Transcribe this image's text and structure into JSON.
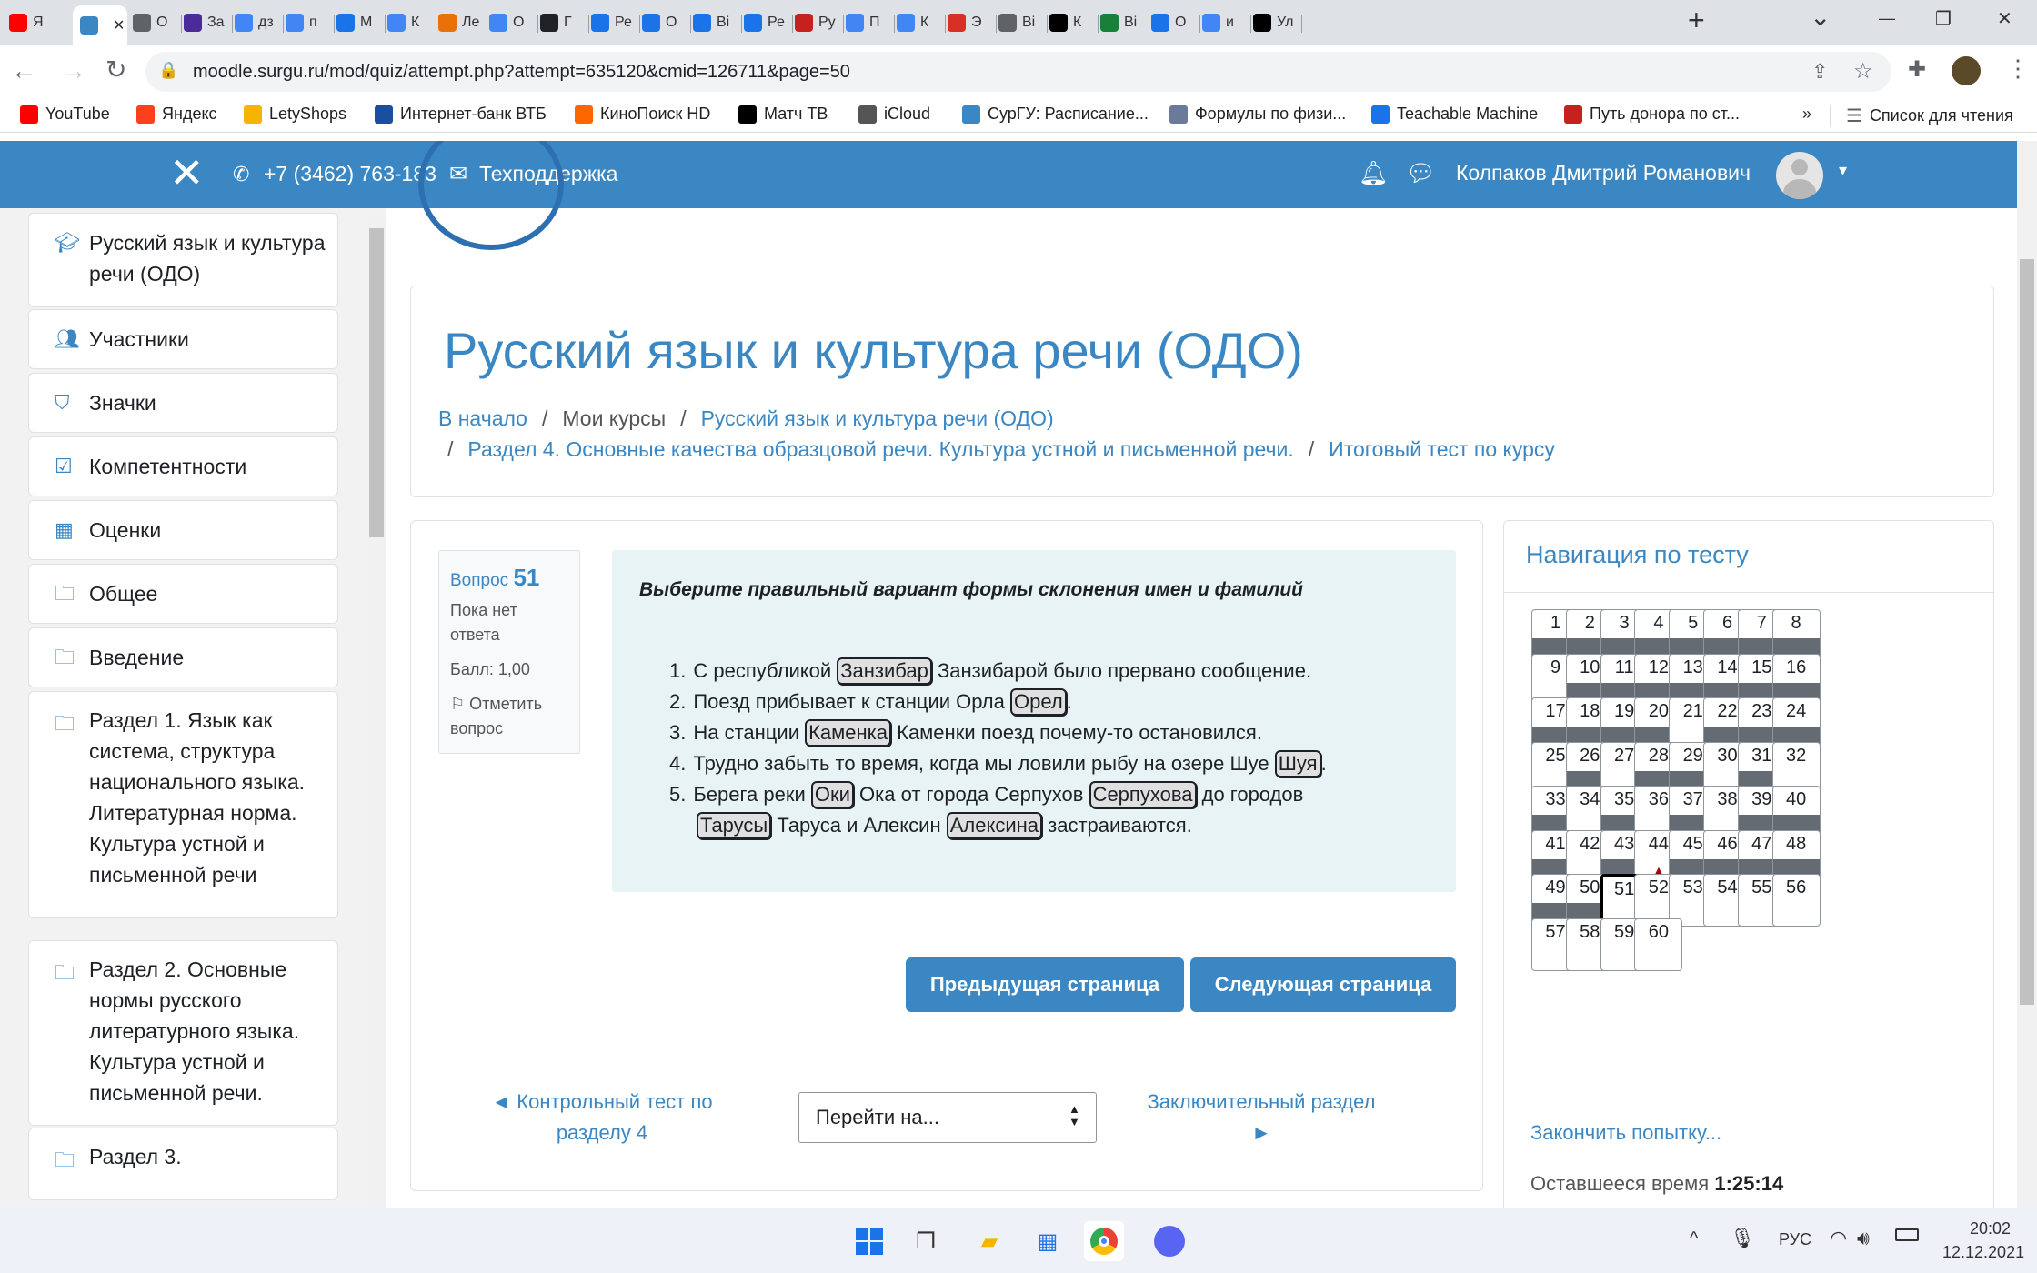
{
  "browser": {
    "tabs": [
      {
        "label": "Я",
        "icon": "youtube-icon",
        "color": "#ff0000"
      },
      {
        "label": "",
        "icon": "moodle-icon",
        "color": "#3a87c4",
        "active": true
      },
      {
        "label": "О",
        "icon": "globe-icon",
        "color": "#5f6368"
      },
      {
        "label": "За",
        "icon": "question-icon",
        "color": "#4b2a9a"
      },
      {
        "label": "дз",
        "icon": "google-icon",
        "color": "#4285f4"
      },
      {
        "label": "п",
        "icon": "google-icon",
        "color": "#4285f4"
      },
      {
        "label": "М",
        "icon": "chat-icon",
        "color": "#1a73e8"
      },
      {
        "label": "К",
        "icon": "google-icon",
        "color": "#4285f4"
      },
      {
        "label": "Ле",
        "icon": "phi-icon",
        "color": "#e8710a"
      },
      {
        "label": "О",
        "icon": "google-icon",
        "color": "#4285f4"
      },
      {
        "label": "Г",
        "icon": "figure-icon",
        "color": "#202124"
      },
      {
        "label": "Ре",
        "icon": "question-circle-icon",
        "color": "#1a73e8"
      },
      {
        "label": "О",
        "icon": "bulb-icon",
        "color": "#1a73e8"
      },
      {
        "label": "Ві",
        "icon": "book-icon",
        "color": "#1a73e8"
      },
      {
        "label": "Ре",
        "icon": "s-icon",
        "color": "#1a73e8"
      },
      {
        "label": "Ру",
        "icon": "emblem-icon",
        "color": "#c5221f"
      },
      {
        "label": "П",
        "icon": "google-icon",
        "color": "#4285f4"
      },
      {
        "label": "К",
        "icon": "google-icon",
        "color": "#4285f4"
      },
      {
        "label": "Э",
        "icon": "briefcase-icon",
        "color": "#d93025"
      },
      {
        "label": "Ві",
        "icon": "globe-icon",
        "color": "#5f6368"
      },
      {
        "label": "К",
        "icon": "m-icon",
        "color": "#000000"
      },
      {
        "label": "Ві",
        "icon": "check-icon",
        "color": "#188038"
      },
      {
        "label": "О",
        "icon": "question-icon",
        "color": "#1a73e8"
      },
      {
        "label": "и",
        "icon": "google-icon",
        "color": "#4285f4"
      },
      {
        "label": "Ул",
        "icon": "3-icon",
        "color": "#000000"
      }
    ],
    "new_tab": "+",
    "url": "moodle.surgu.ru/mod/quiz/attempt.php?attempt=635120&cmid=126711&page=50",
    "bookmarks": [
      {
        "label": "YouTube",
        "icon": "youtube-icon",
        "color": "#ff0000"
      },
      {
        "label": "Яндекс",
        "icon": "yandex-icon",
        "color": "#fc3f1d"
      },
      {
        "label": "LetyShops",
        "icon": "letyshops-icon",
        "color": "#f4b400"
      },
      {
        "label": "Интернет-банк ВТБ",
        "icon": "vtb-icon",
        "color": "#1a4fa0"
      },
      {
        "label": "КиноПоиск HD",
        "icon": "kinopoisk-icon",
        "color": "#ff6600"
      },
      {
        "label": "Матч ТВ",
        "icon": "matchtv-icon",
        "color": "#000000"
      },
      {
        "label": "iCloud",
        "icon": "apple-icon",
        "color": "#555555"
      },
      {
        "label": "СурГУ: Расписание...",
        "icon": "surgu-icon",
        "color": "#3a87c4"
      },
      {
        "label": "Формулы по физи...",
        "icon": "formula-icon",
        "color": "#6a7b9a"
      },
      {
        "label": "Teachable Machine",
        "icon": "tm-icon",
        "color": "#1a73e8"
      },
      {
        "label": "Путь донора по ст...",
        "icon": "donor-icon",
        "color": "#c5221f"
      }
    ],
    "bookmarks_more": "»",
    "reading_list": "Список для чтения"
  },
  "navbar": {
    "phone": "+7 (3462) 763-183",
    "support": "Техподдержка",
    "user_name": "Колпаков Дмитрий Романович"
  },
  "drawer": {
    "items": [
      {
        "label": "Русский язык и культура речи (ОДО)",
        "icon": "graduation-cap-icon"
      },
      {
        "label": "Участники",
        "icon": "users-icon"
      },
      {
        "label": "Значки",
        "icon": "shield-icon"
      },
      {
        "label": "Компетентности",
        "icon": "checkbox-icon"
      },
      {
        "label": "Оценки",
        "icon": "table-icon"
      },
      {
        "label": "Общее",
        "icon": "folder-icon"
      },
      {
        "label": "Введение",
        "icon": "folder-icon"
      },
      {
        "label": "Раздел 1. Язык как система, структура национального языка. Литературная норма. Культура устной и письменной речи",
        "icon": "folder-icon"
      },
      {
        "label": "Раздел 2. Основные нормы русского литературного языка. Культура устной и письменной речи.",
        "icon": "folder-icon"
      },
      {
        "label": "Раздел 3.",
        "icon": "folder-icon"
      }
    ]
  },
  "header": {
    "course_title": "Русский язык и культура речи (ОДО)",
    "breadcrumb": [
      "В начало",
      "Мои курсы",
      "Русский язык и культура речи (ОДО)",
      "Раздел 4. Основные качества образцовой речи. Культура устной и письменной речи.",
      "Итоговый тест по курсу"
    ],
    "separator": "/"
  },
  "question": {
    "label": "Вопрос",
    "number": "51",
    "status": "Пока нет ответа",
    "grade": "Балл: 1,00",
    "flag": "Отметить вопрос",
    "prompt": "Выберите правильный вариант формы склонения имен и фамилий",
    "items": [
      {
        "n": "1.",
        "a": "С республикой ",
        "b1": "Занзибар",
        "c": " Занзибарой было прервано сообщение.",
        "b2": "",
        "d": "",
        "b3": "",
        "e": ""
      },
      {
        "n": "2.",
        "a": "Поезд прибывает к станции Орла ",
        "b1": "Орел",
        "c": ".",
        "b2": "",
        "d": "",
        "b3": "",
        "e": ""
      },
      {
        "n": "3.",
        "a": "На станции ",
        "b1": "Каменка",
        "c": " Каменки поезд почему-то остановился.",
        "b2": "",
        "d": "",
        "b3": "",
        "e": ""
      },
      {
        "n": "4.",
        "a": "Трудно забыть то время, когда мы ловили рыбу на озере Шуе ",
        "b1": "Шуя",
        "c": ".",
        "b2": "",
        "d": "",
        "b3": "",
        "e": ""
      },
      {
        "n": "5.",
        "a": "Берега реки ",
        "b1": "Оки",
        "c": " Ока от города Серпухов ",
        "b2": "Серпухова",
        "d": " до городов",
        "b3": "",
        "e": ""
      }
    ],
    "item5_cont": {
      "b1": "Тарусы",
      "a": " Таруса и Алексин ",
      "b2": "Алексина",
      "c": " застраиваются."
    }
  },
  "buttons": {
    "prev": "Предыдущая страница",
    "next": "Следующая страница"
  },
  "footer_nav": {
    "prev_activity": "◄ Контрольный тест по разделу 4",
    "jump": "Перейти на...",
    "next_activity": "Заключительный раздел ►"
  },
  "quiz_nav": {
    "title": "Навигация по тесту",
    "finish": "Закончить попытку...",
    "time_label": "Оставшееся время",
    "time_value": "1:25:14",
    "answered": [
      1,
      2,
      3,
      4,
      5,
      6,
      7,
      8,
      10,
      11,
      12,
      13,
      14,
      15,
      16,
      17,
      18,
      19,
      20,
      22,
      23,
      24,
      26,
      28,
      29,
      31,
      33,
      35,
      37,
      39,
      40,
      41,
      43,
      45,
      46,
      47,
      48,
      49,
      50
    ],
    "flagged": [
      44
    ],
    "current": 51,
    "total": 60
  },
  "taskbar": {
    "lang": "РУС",
    "time": "20:02",
    "date": "12.12.2021"
  }
}
